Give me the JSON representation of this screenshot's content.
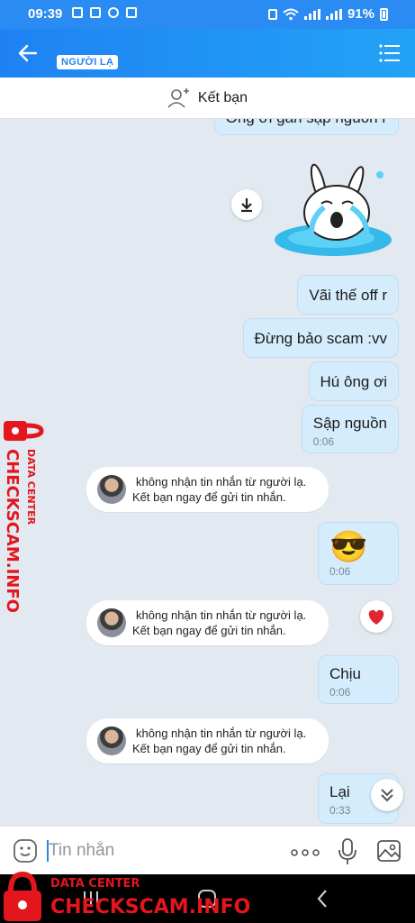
{
  "status_bar": {
    "time": "09:39",
    "battery": "91%"
  },
  "header": {
    "stranger_badge": "NGƯỜI LẠ"
  },
  "add_friend": {
    "label": "Kết bạn"
  },
  "messages": [
    {
      "text": "Ông ơi gần sập nguồn r"
    },
    {
      "text": "Vãi thế off r"
    },
    {
      "text": "Đừng bảo scam :vv"
    },
    {
      "text": "Hú ông ơi"
    },
    {
      "text": "Sập nguồn",
      "time": "0:06"
    },
    {
      "text": "😎",
      "time": "0:06"
    },
    {
      "text": "Chịu",
      "time": "0:06"
    },
    {
      "text": "Lại",
      "time": "0:33"
    }
  ],
  "system_notices": [
    {
      "line1": "không nhận tin nhắn từ người lạ.",
      "line2": "Kết bạn ngay để gửi tin nhắn."
    },
    {
      "line1": "không nhận tin nhắn từ người lạ.",
      "line2": "Kết bạn ngay để gửi tin nhắn."
    },
    {
      "line1": "không nhận tin nhắn từ người lạ.",
      "line2": "Kết bạn ngay để gửi tin nhắn."
    }
  ],
  "composer": {
    "placeholder": "Tin nhắn"
  },
  "watermark": {
    "line1": "DATA CENTER",
    "line2": "CHECKSCAM.INFO"
  },
  "colors": {
    "header": "#1f82f3",
    "bubble": "#d5ecfd",
    "chat_bg": "#e2e9f1",
    "watermark": "#e2161c"
  }
}
